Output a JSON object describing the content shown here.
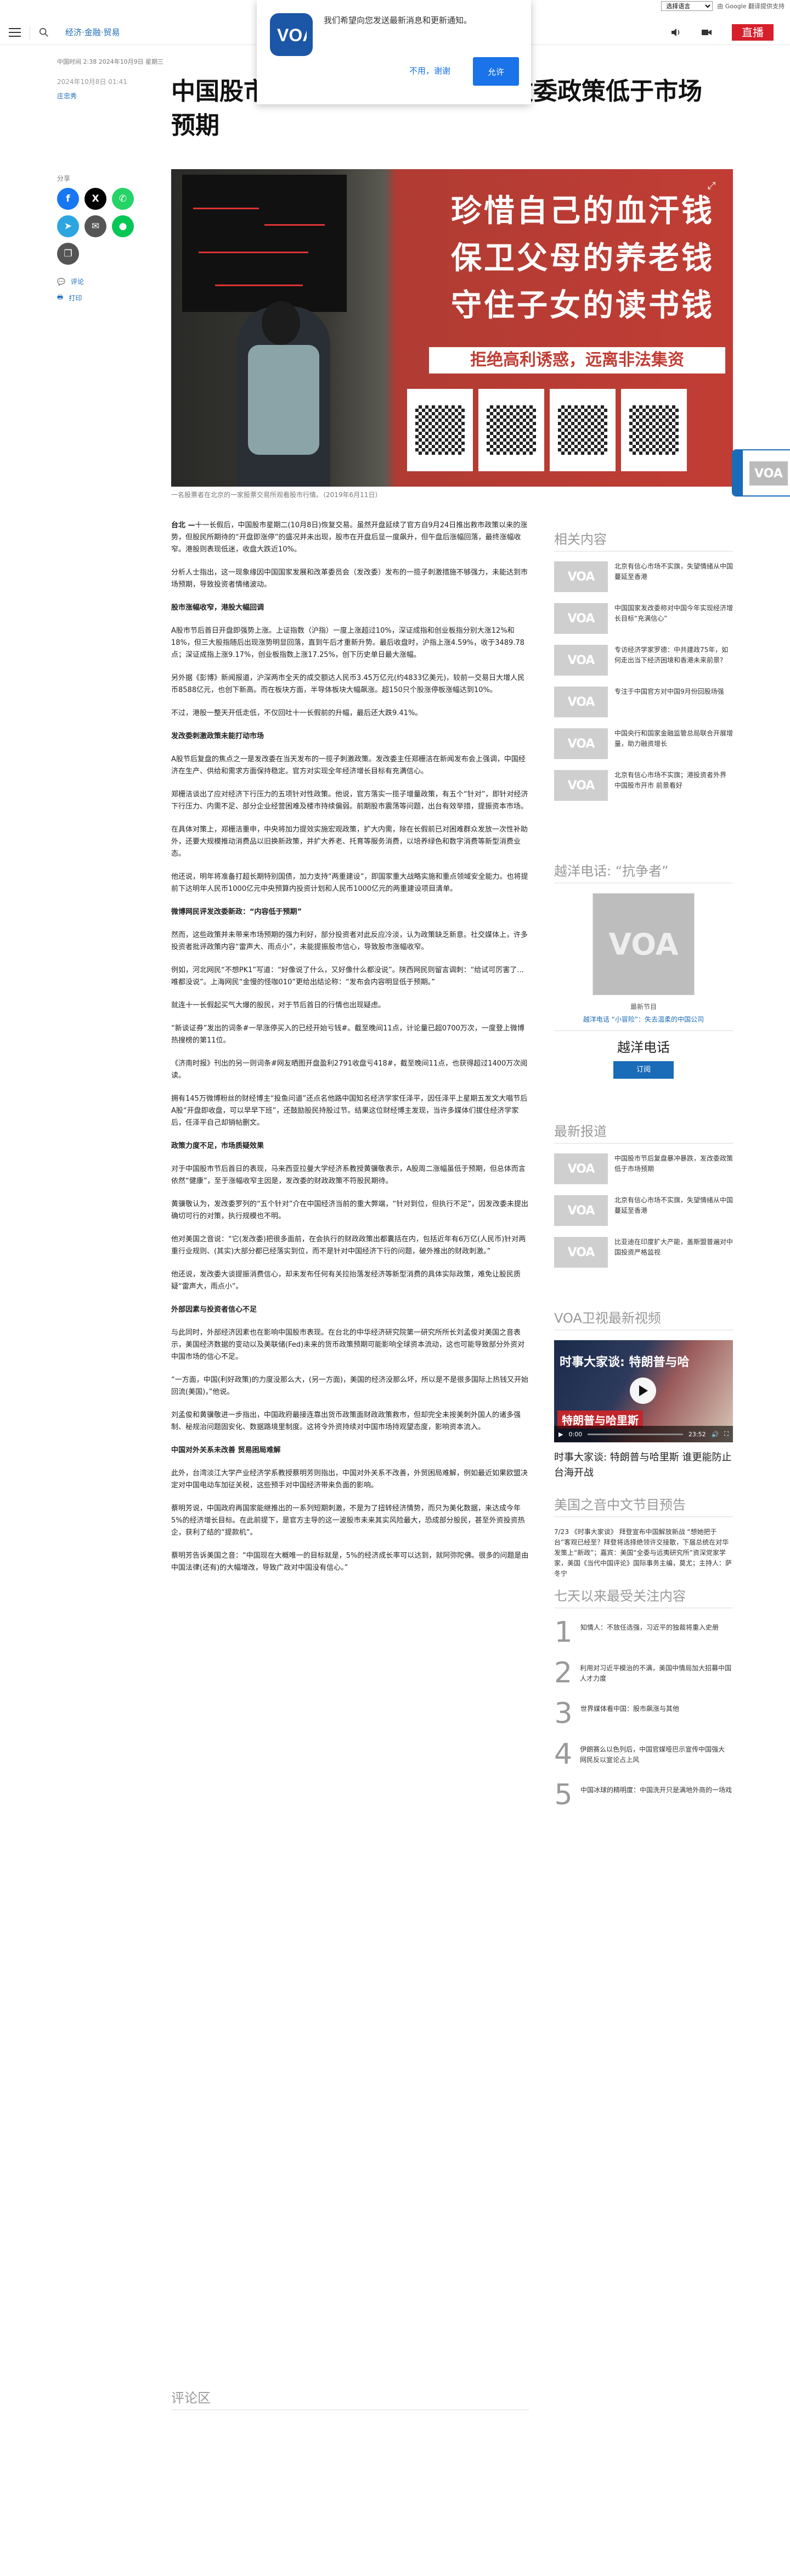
{
  "translate": {
    "select_label": "选择语言",
    "powered_by": "由 Google 翻译提供支持"
  },
  "header": {
    "section": "经济·金融·贸易",
    "live_label": "直播"
  },
  "notification": {
    "message": "我们希望向您发送最新消息和更新通知。",
    "later_label": "不用，谢谢",
    "allow_label": "允许"
  },
  "meta": {
    "site_date": "中国时间 2:38 2024年10月9日 星期三",
    "timestamp": "2024年10月8日 01:41",
    "author": "庄忠秀"
  },
  "headline": "中国股市节后复盘暴冲暴跌，发改委政策低于市场预期",
  "share": {
    "label": "分享",
    "comments_link": "评论",
    "print_link": "打印"
  },
  "hero": {
    "banner_lines": [
      "珍惜自己的血汗钱",
      "保卫父母的养老钱",
      "守住子女的读书钱"
    ],
    "sub_banner": "拒绝高利诱惑，远离非法集资",
    "caption": "一名股票者在北京的一家股票交易所观看股市行情。（2019年6月11日）"
  },
  "float_widget": {
    "logo": "VOA"
  },
  "article": {
    "dateline": "台北 —",
    "blocks": [
      {
        "t": "p",
        "text": "十一长假后，中国股市星期二(10月8日)恢复交易。虽然开盘延续了官方自9月24日推出救市政策以来的涨势，但股民所期待的“开盘即涨停”的盛况并未出现，股市在开盘后显一度飙升，但午盘后涨幅回落，最终涨幅收窄。港股则表现低迷，收盘大跌近10%。"
      },
      {
        "t": "p",
        "text": "分析人士指出，这一现象缘因中国国家发展和改革委员会（发改委）发布的一揽子刺激措施不够强力，未能达到市场预期，导致投资者情绪波动。"
      },
      {
        "t": "h",
        "text": "股市涨幅收窄，港股大幅回调"
      },
      {
        "t": "p",
        "text": "A股市节后首日开盘即强势上涨。上证指数（沪指）一度上涨超过10%，深证成指和创业板指分别大涨12%和18%，但三大股指随后出现涨势明显回落，直到午后才重新升势。最后收盘时，沪指上涨4.59%，收于3489.78点；深证成指上涨9.17%，创业板指数上涨17.25%，创下历史单日最大涨幅。"
      },
      {
        "t": "p",
        "text": "另外据《彭博》新闻报道，沪深两市全天的成交额达人民币3.45万亿元(约4833亿美元)，较前一交易日大增人民币8588亿元，也创下新高。而在板块方面，半导体板块大幅飙涨。超150只个股涨停板涨幅达到10%。"
      },
      {
        "t": "p",
        "text": "不过，港股一整天开低走低，不仅回吐十一长假前的升幅，最后还大跌9.41%。"
      },
      {
        "t": "h",
        "text": "发改委刺激政策未能打动市场"
      },
      {
        "t": "p",
        "text": "A股节后复盘的焦点之一是发改委在当天发布的一揽子刺激政策。发改委主任郑栅洁在新闻发布会上强调，中国经济在生产、供给和需求方面保持稳定。官方对实现全年经济增长目标有充满信心。"
      },
      {
        "t": "p",
        "text": "郑栅洁谈出了应对经济下行压力的五项针对性政策。他说，官方落实一揽子增量政策，有五个“针对”，即针对经济下行压力、内需不足、部分企业经营困难及楼市持续偏弱。前期股市震荡等问题，出台有效举措，提振资本市场。"
      },
      {
        "t": "p",
        "text": "在具体对策上，郑栅洁重申，中央将加力提效实施宏观政策，扩大内需，除在长假前已对困难群众发放一次性补助外，还要大规模推动消费品以旧换新政策，并扩大养老、托育等服务消费，以培养绿色和数字消费等新型消费业态。"
      },
      {
        "t": "p",
        "text": "他还说，明年将准备打超长期特别国债，加力支持“两重建设”，即国家重大战略实施和重点领域安全能力。也将提前下达明年人民币1000亿元中央预算内投资计划和人民币1000亿元的两重建设项目清单。"
      },
      {
        "t": "h",
        "text": "微博网民评发改委新政：“内容低于预期”"
      },
      {
        "t": "p",
        "text": "然而，这些政策并未带来市场预期的强力利好，部分投资者对此反应冷淡，认为政策缺乏新意。社交媒体上，许多投资者批评政策内容“雷声大、雨点小”，未能提振股市信心，导致股市涨幅收窄。"
      },
      {
        "t": "p",
        "text": "例如，河北网民“不想PK1”写道：“好像说了什么，又好像什么都没说”。陕西网民则留言调刺：“给试可厉害了...唯都没说”。上海网民“金慢的怪咖010”更给出结论称：“发布会内容明显低于预期。”"
      },
      {
        "t": "p",
        "text": "就连十一长假起买气大爆的股民，对于节后首日的行情也出现疑虑。"
      },
      {
        "t": "p",
        "text": "“新谈证券”发出的词条#一早涨停买入的已经开始亏钱#。截至晚间11点，计论量已超0700万次，一度登上微博热搜榜的第11位。"
      },
      {
        "t": "p",
        "text": "《济南时报》刊出的另一则词条#网友晒图开盘盈利2791收盘亏418#，截至晚间11点，也获得超过1400万次阅读。"
      },
      {
        "t": "p",
        "text": "拥有145万微博粉丝的财经博主“投鱼问道”还点名他路中国知名经济学家任泽平，因任泽平上星期五发文大唱节后A股“开盘即收盘，可以早早下班”，还鼓励股民持股过节。结果这位财经博主发现，当许多媒体们拔住经济学家后，任泽平自己却销帖删文。"
      },
      {
        "t": "h",
        "text": "政策力度不足，市场质疑效果"
      },
      {
        "t": "p",
        "text": "对于中国股市节后首日的表现，马来西亚拉曼大学经济系教授黄骥敬表示，A股周二涨幅虽低于预期，但总体而言依然“健康”，至于涨幅收窄主因是，发改委的财政政策不符股民期待。"
      },
      {
        "t": "p",
        "text": "黄骥敬认为，发改委罗列的“五个针对”介在中国经济当前的重大弊端，“针对到位，但执行不足”，因发改委未提出确切可行的对策，执行规模也不明。"
      },
      {
        "t": "p",
        "text": "他对美国之音说：“它(发改委)把很多面前，在会执行的财政政策出都囊括在内，包括近年有6万亿(人民币)针对两重行业规则、(其实)大部分都已经落实到位，而不是针对中国经济下行的问题，破外推出的财政刺激。”"
      },
      {
        "t": "p",
        "text": "他还说，发改委大谈提振消费信心，却未发布任何有关拉抬落发经济等新型消费的具体实际政策，难免让股民质疑“雷声大，雨点小”。"
      },
      {
        "t": "h",
        "text": "外部因素与投资者信心不足"
      },
      {
        "t": "p",
        "text": "与此同时，外部经济因素也在影响中国股市表现。在台北的中华经济研究院第一研究所所长刘孟俊对美国之音表示，美国经济数据的变动以及美联储(Fed)未来的货币政策预期可能影响全球资本流动，这也可能导致部分外资对中国市场的信心不足。"
      },
      {
        "t": "p",
        "text": "“一方面，中国(利好政策)的力度没那么大，(另一方面)，美国的经济没那么坏，所以是不是很多国际上热钱又开始回流(美国)，”他说。"
      },
      {
        "t": "p",
        "text": "刘孟俊和黄骥敬进一步指出，中国政府最接连靠出货币政策面财政政策救市，但却完全未按美刺外国人的诸多强制、秘规治问题固安化、数据路境里制度。这将令外资持续对中国市场持观望态度，影响资本流入。"
      },
      {
        "t": "h",
        "text": "中国对外关系未改善 贸易困局难解"
      },
      {
        "t": "p",
        "text": "此外，台湾淡江大学产业经济学系教授蔡明芳则指出，中国对外关系不改善，外贸困局难解，例如最近如果欧盟决定对中国电动车加征关税，这些预手对中国经济带来负面的影响。"
      },
      {
        "t": "p",
        "text": "蔡明芳说，中国政府再国家能继推出的一系列短期刺激，不是为了扭转经济情势，而只为美化数据，来达成今年5%的经济增长目标。在此前提下，是官方主导的这一波股市未来其实风险最大，恐成部分股民，甚至外资投资热企，获利了结的“提款机”。"
      },
      {
        "t": "p",
        "text": "蔡明芳告诉美国之音：“中国现在大概唯一的目标就是，5%的经济成长率可以达到，就阿弥陀佛。很多的问题是由中国法律(还有)的大幅增改，导致广政对中国没有信心。”"
      }
    ]
  },
  "comments_title": "评论区",
  "related": {
    "title": "相关内容",
    "items": [
      {
        "text": "北京有信心市场不实旗，失望情绪从中国蔓延至香港"
      },
      {
        "text": "中国国家发改委称对中国今年实现经济增长目标“充满信心”"
      },
      {
        "text": "专访经济学家罗德：中共建政75年，如何走出当下经济困境和香港未来前景?"
      },
      {
        "text": "专注于中国官方对中国9月份回股场强"
      },
      {
        "text": "中国央行和国家金融监管总局联合开展增量，助力融资增长"
      },
      {
        "text": "北京有信心市场不实旗；港投资者外界 中国股市开市 前景看好"
      }
    ]
  },
  "podcast": {
    "title": "越洋电话: “抗争者”",
    "kicker": "最新节目",
    "desc": "越洋电话 “小冒险”：失去温柔的中国公司",
    "name": "越洋电话",
    "button": "订阅"
  },
  "latest": {
    "title": "最新报道",
    "items": [
      {
        "text": "中国股市节后复盘暴冲暴跌，发改委政策低于市场预期"
      },
      {
        "text": "北京有信心市场不实旗，失望情绪从中国蔓延至香港"
      },
      {
        "text": "比亚迪在印度扩大产能，盖斯盟普遍对中国投资严格监视"
      }
    ]
  },
  "video": {
    "title": "VOA卫视最新视频",
    "overlay_title": "时事大家谈: 特朗普与哈",
    "overlay_bar": "特朗普与哈里斯",
    "time": "0:00",
    "duration": "23:52",
    "caption": "时事大家谈: 特朗普与哈里斯 谁更能防止台海开战"
  },
  "schedule": {
    "title": "美国之音中文节目预告",
    "text": "7/23 《时事大家谈》 拜登宣布中国解放新战 “想她把于台”客观已经至？拜登将选择绝领许交接散，下届总统在对华发策上“新政”；嘉宾：美国“全委与远夷研究所”资深党家学家，美国《当代中国评论》国际事务主编，莫尤；主持人：萨冬宁"
  },
  "popular": {
    "title": "七天以来最受关注内容",
    "items": [
      {
        "num": "1",
        "text": "知情人：不放任选强，习近平的独裁将重入史册"
      },
      {
        "num": "2",
        "text": "利用对习近平模治的不满，美国中情局加大招募中国人才力度"
      },
      {
        "num": "3",
        "text": "世界媒体看中国：股市飙涨与其他"
      },
      {
        "num": "4",
        "text": "伊朗赛么以色列后，中国官媒哑巴示宣传中国强大 网民反以宣论占上风"
      },
      {
        "num": "5",
        "text": "中国冰球的精明度：中国洗开只是满地外商的一场戏"
      }
    ]
  },
  "colors": {
    "accent": "#1a6bb8",
    "live": "#d71f2b",
    "banner": "#c13d34"
  }
}
